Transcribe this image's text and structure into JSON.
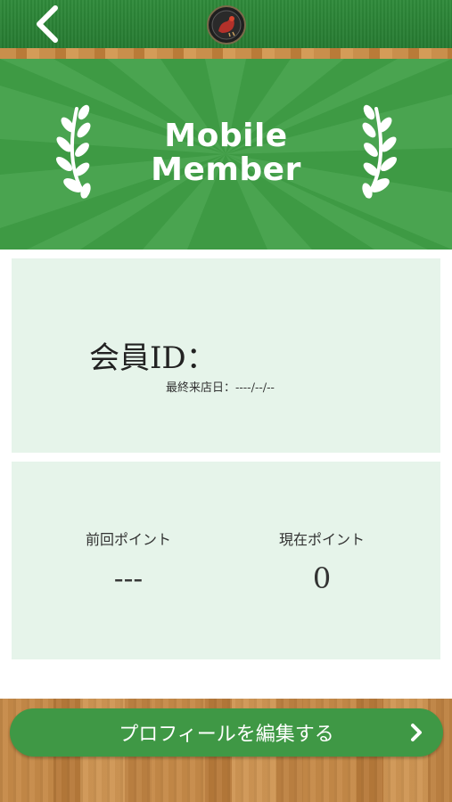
{
  "header": {
    "back_icon": "chevron-left-icon",
    "logo_icon": "rooster-logo-icon"
  },
  "banner": {
    "title_line1": "Mobile",
    "title_line2": "Member",
    "decoration": "laurel-icon"
  },
  "member_card": {
    "id_label": "会員ID：",
    "last_visit_label": "最終来店日：----/--/--"
  },
  "points": {
    "previous_label": "前回ポイント",
    "previous_value": "---",
    "current_label": "現在ポイント",
    "current_value": "0"
  },
  "actions": {
    "edit_profile_label": "プロフィールを編集する",
    "edit_profile_icon": "chevron-right-icon"
  },
  "colors": {
    "header_green": "#2f8a3a",
    "banner_green": "#3e9a44",
    "card_bg": "#e6f4ea",
    "button_green": "#3f9845",
    "wood": "#c68a48"
  }
}
